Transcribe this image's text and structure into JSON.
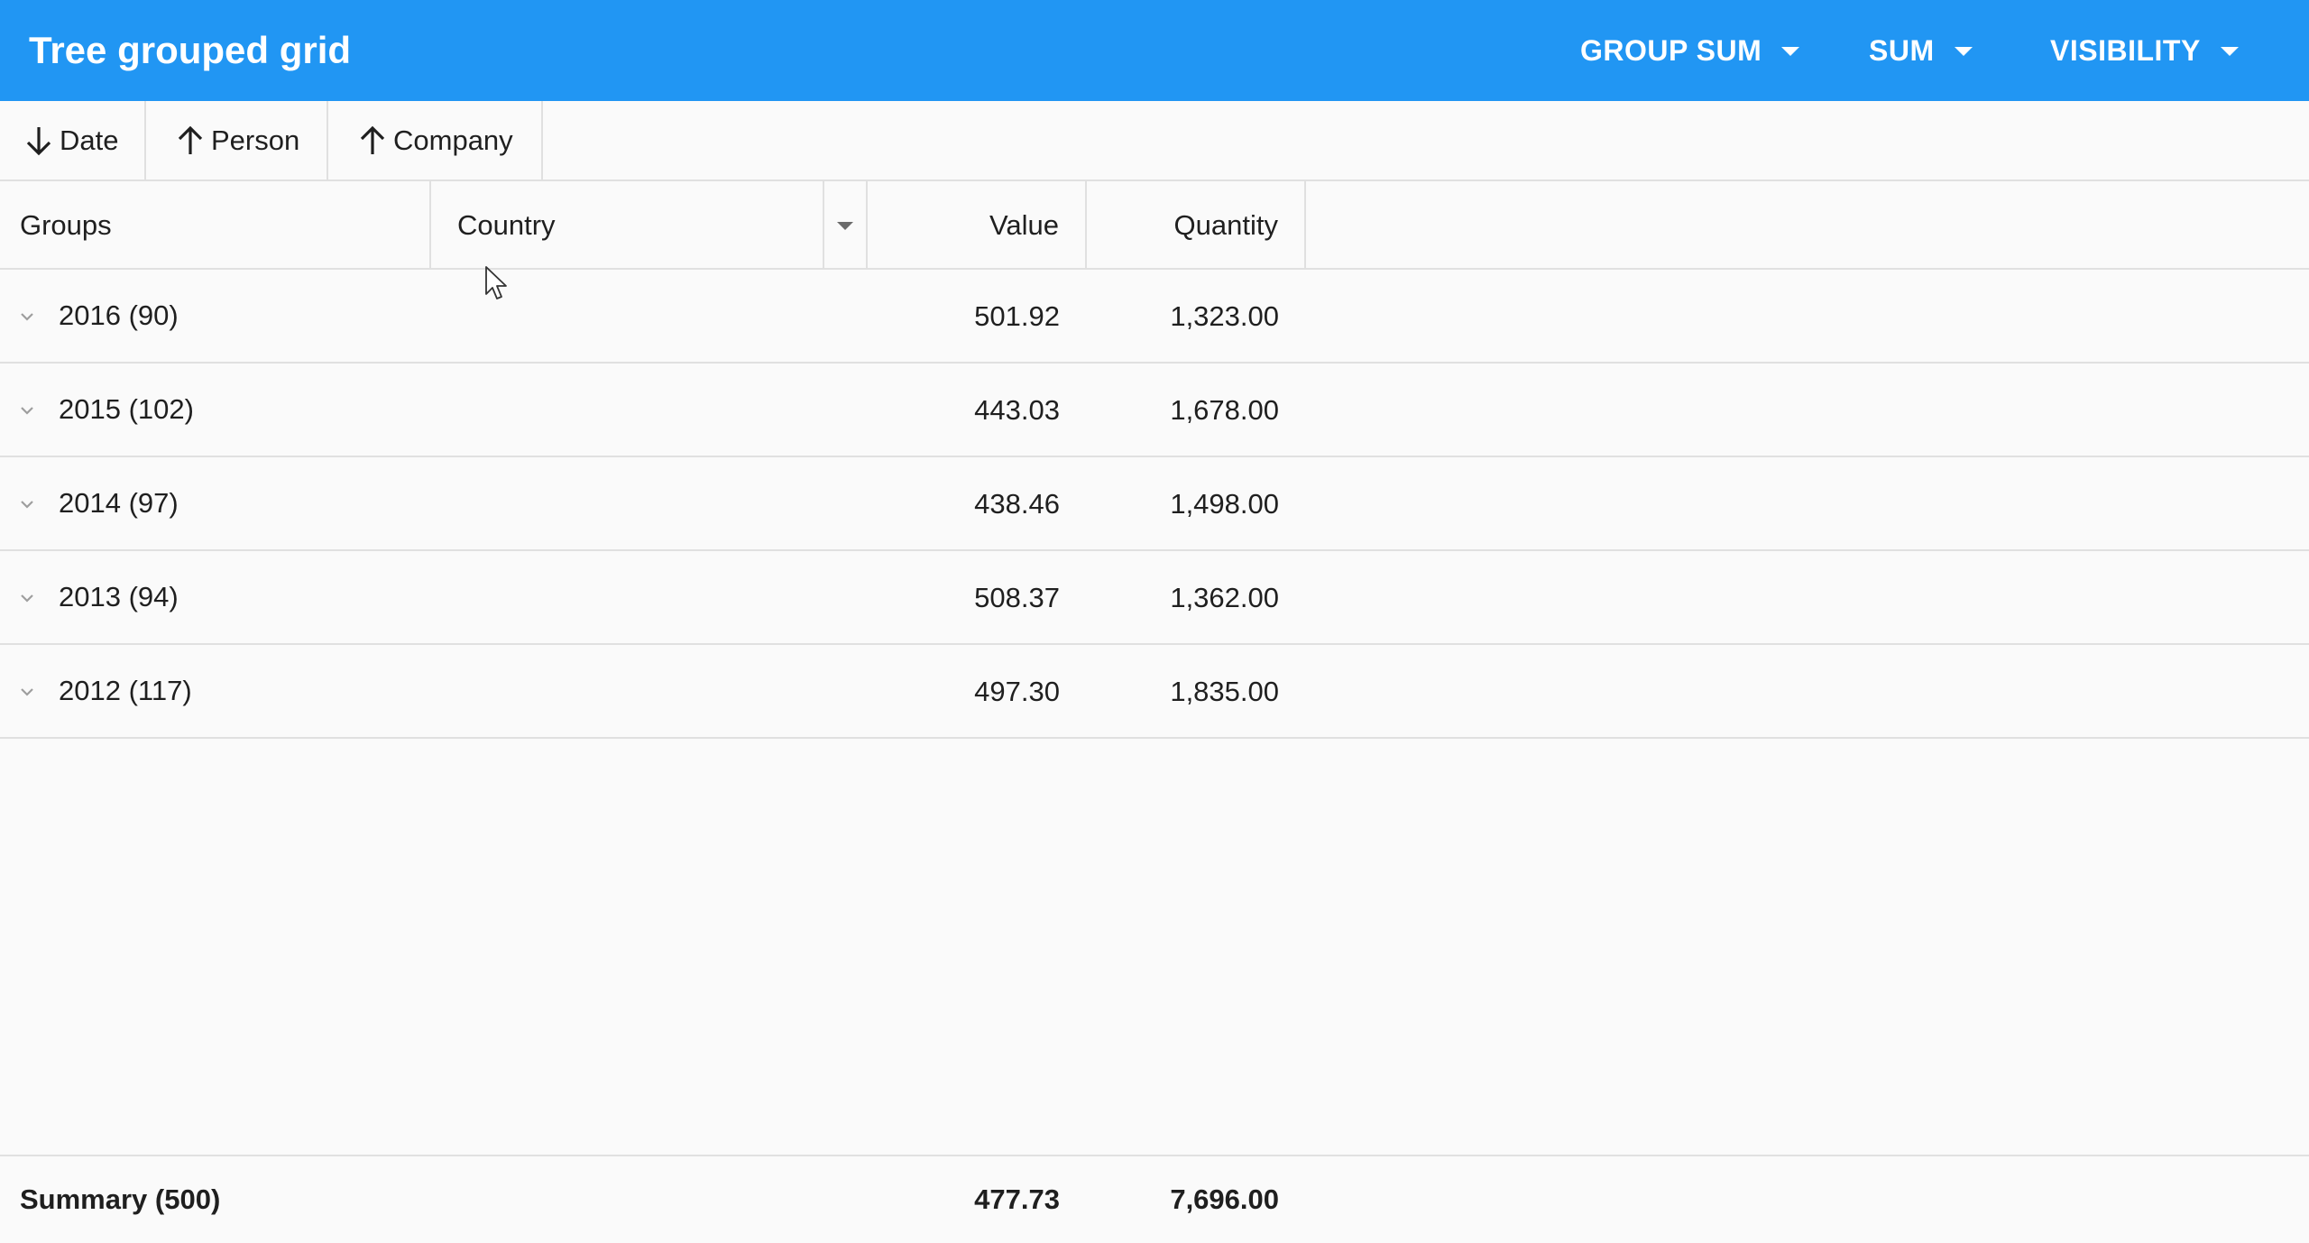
{
  "header": {
    "title": "Tree grouped grid",
    "menus": [
      {
        "label": "GROUP SUM"
      },
      {
        "label": "SUM"
      },
      {
        "label": "VISIBILITY"
      }
    ]
  },
  "grouping": {
    "chips": [
      {
        "label": "Date",
        "direction": "desc",
        "icon": "arrow-down-icon"
      },
      {
        "label": "Person",
        "direction": "asc",
        "icon": "arrow-up-icon"
      },
      {
        "label": "Company",
        "direction": "asc",
        "icon": "arrow-up-icon"
      }
    ]
  },
  "columns": {
    "groups": "Groups",
    "country": "Country",
    "value": "Value",
    "quantity": "Quantity"
  },
  "rows": [
    {
      "label": "2016 (90)",
      "value": "501.92",
      "quantity": "1,323.00"
    },
    {
      "label": "2015 (102)",
      "value": "443.03",
      "quantity": "1,678.00"
    },
    {
      "label": "2014 (97)",
      "value": "438.46",
      "quantity": "1,498.00"
    },
    {
      "label": "2013 (94)",
      "value": "508.37",
      "quantity": "1,362.00"
    },
    {
      "label": "2012 (117)",
      "value": "497.30",
      "quantity": "1,835.00"
    }
  ],
  "summary": {
    "label": "Summary (500)",
    "value": "477.73",
    "quantity": "7,696.00"
  },
  "colors": {
    "header_bg": "#2196f3",
    "page_bg": "#fafafa",
    "divider": "#e0e0e0"
  },
  "icons": {
    "row_toggle": "chevron-down-icon",
    "country_filter": "caret-down-icon",
    "menu_toggle": "caret-down-icon"
  }
}
